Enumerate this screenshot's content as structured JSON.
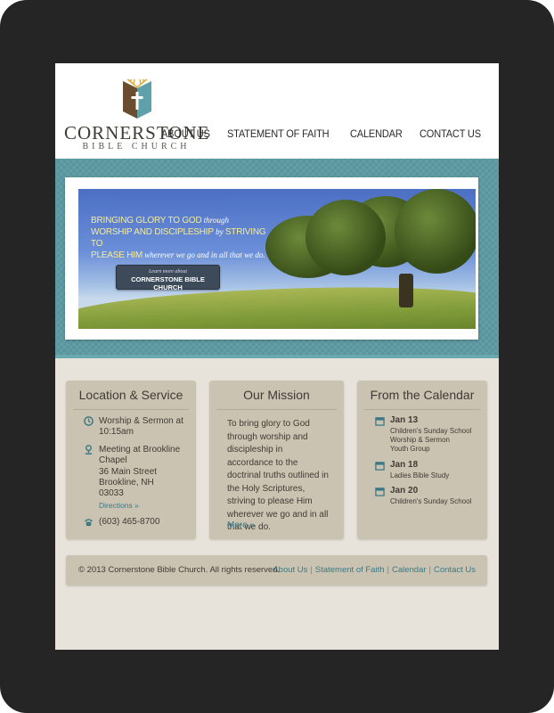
{
  "site": {
    "logo_name": "CORNERSTONE",
    "logo_sub": "BIBLE CHURCH",
    "colors": {
      "accent": "#3a7a85",
      "band": "#5d9aa3",
      "panel": "#cbc3b2",
      "page": "#e7e2da"
    }
  },
  "nav": {
    "items": [
      "ABOUT US",
      "STATEMENT OF FAITH",
      "CALENDAR",
      "CONTACT US"
    ]
  },
  "hero": {
    "line1_cap": "Bringing glory to God",
    "line1_it": "through",
    "line2_cap": "worship and discipleship",
    "line2_it": "by",
    "line2_cap2": "striving to",
    "line3_cap": "please Him",
    "line3_it": "wherever we go and in all that we do.",
    "button_small": "Learn more about",
    "button_big": "CORNERSTONE BIBLE CHURCH"
  },
  "location": {
    "title": "Location & Service",
    "service": "Worship & Sermon at 10:15am",
    "meeting": "Meeting at Brookline Chapel",
    "address1": "36 Main Street",
    "address2": "Brookline, NH",
    "zip": "03033",
    "directions": "Directions »",
    "phone": "(603) 465-8700",
    "icons": [
      "clock-icon",
      "map-pin-icon",
      "phone-icon"
    ]
  },
  "mission": {
    "title": "Our Mission",
    "text": "To bring glory to God through worship and discipleship in accordance to the doctrinal truths outlined in the Holy Scriptures, striving to please Him wherever we go and in all that we do.",
    "more": "More »"
  },
  "calendar": {
    "title": "From the Calendar",
    "events": [
      {
        "date": "Jan 13",
        "lines": [
          "Children's Sunday School",
          "Worship & Sermon",
          "Youth Group"
        ]
      },
      {
        "date": "Jan 18",
        "lines": [
          "Ladies Bible Study"
        ]
      },
      {
        "date": "Jan 20",
        "lines": [
          "Children's Sunday School"
        ]
      }
    ]
  },
  "footer": {
    "copyright": "© 2013 Cornerstone Bible Church. All rights reserved.",
    "links": [
      "About Us",
      "Statement of Faith",
      "Calendar",
      "Contact Us"
    ]
  }
}
